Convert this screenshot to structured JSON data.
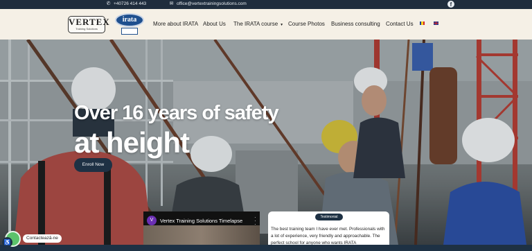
{
  "topbar": {
    "phone": "+40726 414 443",
    "email": "office@vertextrainingsolutions.com",
    "social_icon": "facebook-icon"
  },
  "logos": {
    "vertex_name": "VERTEX",
    "vertex_tagline": "Training Solutions",
    "irata_name": "irata"
  },
  "nav": {
    "items": [
      {
        "label": "More about IRATA"
      },
      {
        "label": "About Us"
      },
      {
        "label": "The IRATA course"
      },
      {
        "label": "Course Photos"
      },
      {
        "label": "Business consulting"
      },
      {
        "label": "Contact Us"
      }
    ],
    "languages": [
      "ro-flag-icon",
      "gb-flag-icon"
    ]
  },
  "hero": {
    "title_line1": "Over 16 years of safety",
    "title_line2": "at height",
    "cta_label": "Enroll Now"
  },
  "video": {
    "channel_initial": "V",
    "title": "Vertex Training Solutions Timelapse"
  },
  "testimonial": {
    "tag": "Testimonial",
    "text": "The best training team I have ever met. Professionals with a lot of experience, very friendly and approachable. The perfect school for anyone who wants IRATA"
  },
  "contact": {
    "label": "Contactează-ne"
  },
  "colors": {
    "navy": "#1e3144",
    "cream": "#f5f0e6",
    "whatsapp": "#5cc26b"
  }
}
